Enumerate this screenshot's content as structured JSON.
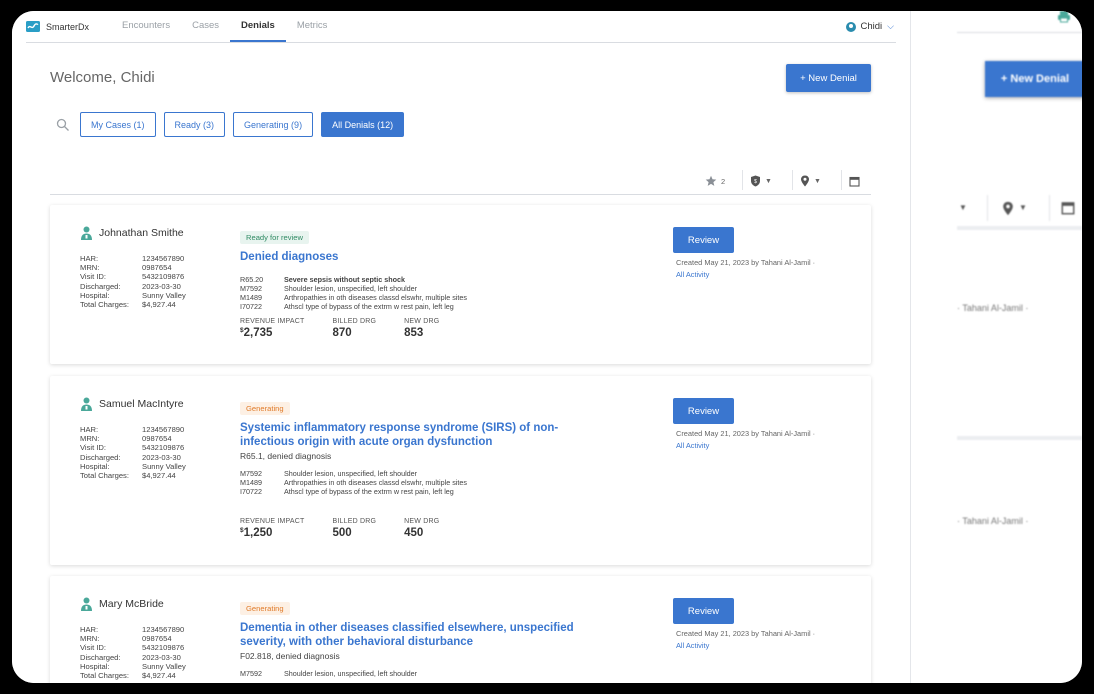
{
  "app": {
    "brand": "SmarterDx"
  },
  "nav": {
    "tabs": [
      {
        "label": "Encounters",
        "active": false
      },
      {
        "label": "Cases",
        "active": false
      },
      {
        "label": "Denials",
        "active": true
      },
      {
        "label": "Metrics",
        "active": false
      }
    ],
    "user": "Chidi"
  },
  "page": {
    "welcome": "Welcome, Chidi",
    "new_denial": "+ New Denial"
  },
  "filters": [
    {
      "label": "My Cases (1)",
      "active": false
    },
    {
      "label": "Ready (3)",
      "active": false
    },
    {
      "label": "Generating (9)",
      "active": false
    },
    {
      "label": "All Denials (12)",
      "active": true
    }
  ],
  "toolbar": {
    "star_count": "2"
  },
  "labels": {
    "har": "HAR:",
    "mrn": "MRN:",
    "visit": "Visit ID:",
    "discharged": "Discharged:",
    "hospital": "Hospital:",
    "charges": "Total Charges:",
    "revenue": "REVENUE IMPACT",
    "billed": "BILLED DRG",
    "new": "NEW DRG",
    "review": "Review",
    "all_activity": "All Activity"
  },
  "cards": [
    {
      "name": "Johnathan Smithe",
      "har": "1234567890",
      "mrn": "0987654",
      "visit": "5432109876",
      "discharged": "2023-03-30",
      "hospital": "Sunny Valley",
      "charges": "$4,927.44",
      "badge": "Ready for review",
      "title1": "Denied diagnoses",
      "title2": "",
      "subtitle": "",
      "codes": [
        {
          "code": "R65.20",
          "desc": "Severe sepsis without septic shock"
        },
        {
          "code": "M7592",
          "desc": "Shoulder lesion, unspecified, left shoulder"
        },
        {
          "code": "M1489",
          "desc": "Arthropathies in oth diseases classd elswhr, multiple sites"
        },
        {
          "code": "I70722",
          "desc": "Athscl type of bypass of the extrm w rest pain, left leg"
        }
      ],
      "revenue_symbol": "$",
      "revenue": "2,735",
      "billed": "870",
      "new": "853",
      "created": "Created May 21, 2023 by Tahani Al-Jamil ·"
    },
    {
      "name": "Samuel MacIntyre",
      "har": "1234567890",
      "mrn": "0987654",
      "visit": "5432109876",
      "discharged": "2023-03-30",
      "hospital": "Sunny Valley",
      "charges": "$4,927.44",
      "badge": "Generating",
      "title1": "Systemic inflammatory response syndrome (SIRS) of non-",
      "title2": "infectious origin with acute organ dysfunction",
      "subtitle": "R65.1, denied diagnosis",
      "codes": [
        {
          "code": "M7592",
          "desc": "Shoulder lesion, unspecified, left shoulder"
        },
        {
          "code": "M1489",
          "desc": "Arthropathies in oth diseases classd elswhr, multiple sites"
        },
        {
          "code": "I70722",
          "desc": "Athscl type of bypass of the extrm w rest pain, left leg"
        }
      ],
      "revenue_symbol": "$",
      "revenue": "1,250",
      "billed": "500",
      "new": "450",
      "created": "Created May 21, 2023 by Tahani Al-Jamil ·"
    },
    {
      "name": "Mary McBride",
      "har": "1234567890",
      "mrn": "0987654",
      "visit": "5432109876",
      "discharged": "2023-03-30",
      "hospital": "Sunny Valley",
      "charges": "$4,927.44",
      "badge": "Generating",
      "title1": "Dementia in other diseases classified elsewhere, unspecified",
      "title2": "severity, with other behavioral disturbance",
      "subtitle": "F02.818, denied diagnosis",
      "codes": [
        {
          "code": "M7592",
          "desc": "Shoulder lesion, unspecified, left shoulder"
        }
      ],
      "created": "Created May 21, 2023 by Tahani Al-Jamil ·"
    }
  ],
  "side": {
    "new_denial": "+ New Denial",
    "creator1": "· Tahani Al-Jamil ·",
    "creator2": "· Tahani Al-Jamil ·"
  },
  "colors": {
    "accent": "#3a76cf",
    "ready": "#2f8a63",
    "generating": "#e07b2a"
  }
}
